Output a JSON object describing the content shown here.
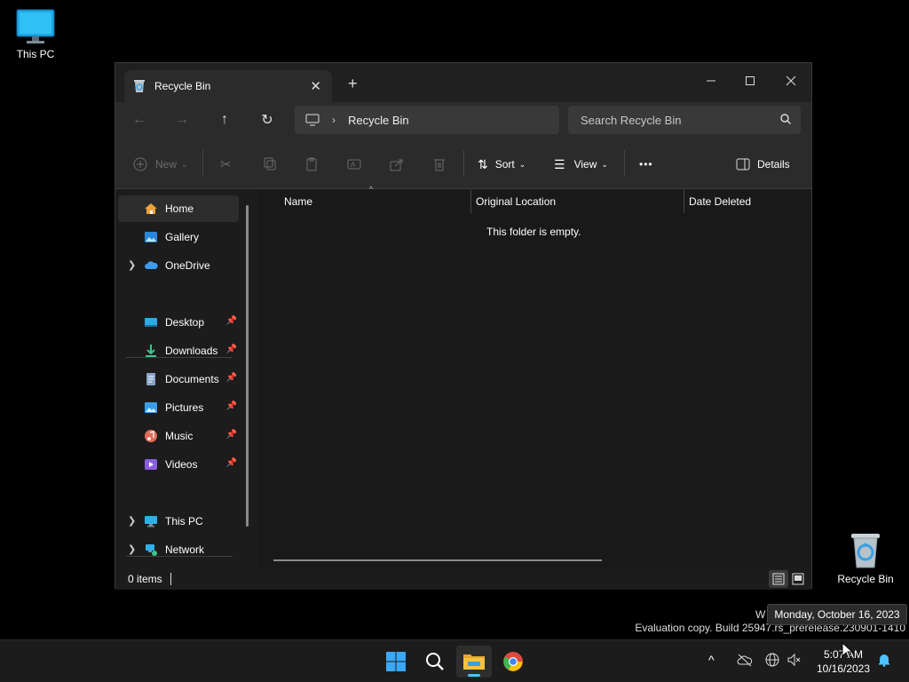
{
  "desktop": {
    "this_pc_label": "This PC",
    "recycle_bin_label": "Recycle Bin"
  },
  "window": {
    "tab_title": "Recycle Bin",
    "new_tab": "+",
    "breadcrumb": "Recycle Bin",
    "search_placeholder": "Search Recycle Bin",
    "toolbar": {
      "new_label": "New",
      "sort_label": "Sort",
      "view_label": "View",
      "more_label": "•••",
      "details_label": "Details"
    },
    "sidebar": {
      "home": "Home",
      "gallery": "Gallery",
      "onedrive": "OneDrive",
      "desktop": "Desktop",
      "downloads": "Downloads",
      "documents": "Documents",
      "pictures": "Pictures",
      "music": "Music",
      "videos": "Videos",
      "this_pc": "This PC",
      "network": "Network"
    },
    "columns": {
      "name": "Name",
      "original_location": "Original Location",
      "date_deleted": "Date Deleted"
    },
    "empty_message": "This folder is empty.",
    "status_items": "0 items"
  },
  "overlay": {
    "watermark_w": "W",
    "watermark": "Evaluation copy. Build 25947.rs_prerelease.230901-1410",
    "tooltip": "Monday, October 16, 2023"
  },
  "taskbar": {
    "time": "5:07 AM",
    "date": "10/16/2023"
  },
  "colors": {
    "accent": "#4cc2ff",
    "folder_yellow": "#f5c33b"
  }
}
